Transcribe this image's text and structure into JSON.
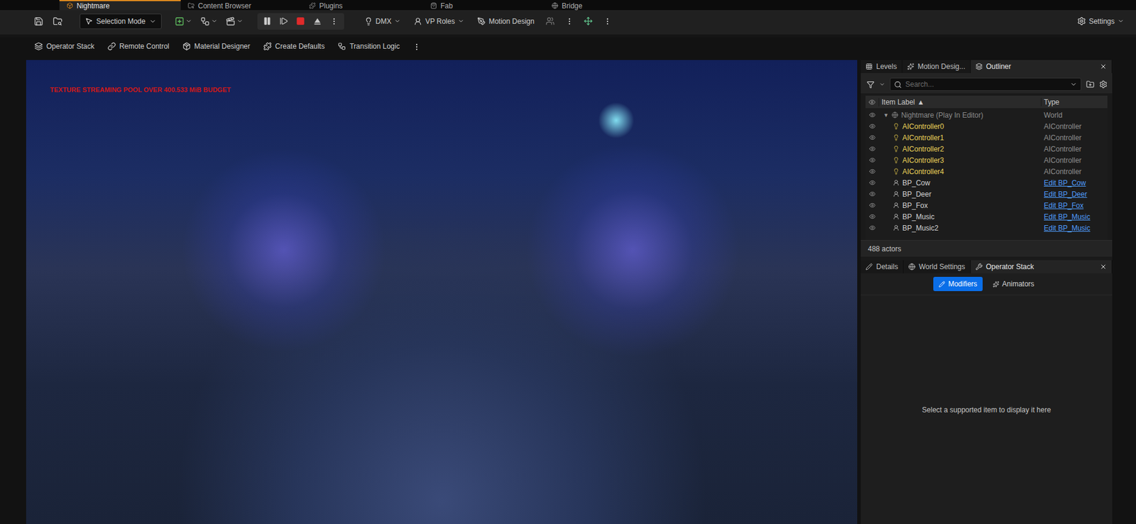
{
  "window_tabs": [
    {
      "label": "Nightmare",
      "selected": true
    },
    {
      "label": "Content Browser",
      "selected": false
    },
    {
      "label": "Plugins",
      "selected": false
    },
    {
      "label": "Fab",
      "selected": false
    },
    {
      "label": "Bridge",
      "selected": false
    }
  ],
  "toolbar": {
    "mode": "Selection Mode",
    "menus": [
      "DMX",
      "VP Roles",
      "Motion Design"
    ],
    "settings": "Settings"
  },
  "quick_bar": [
    "Operator Stack",
    "Remote Control",
    "Material Designer",
    "Create Defaults",
    "Transition Logic"
  ],
  "viewport": {
    "warning": "TEXTURE STREAMING POOL OVER 400.533 MiB BUDGET"
  },
  "outliner": {
    "tabs": [
      {
        "label": "Levels",
        "selected": false
      },
      {
        "label": "Motion Desig...",
        "selected": false
      },
      {
        "label": "Outliner",
        "selected": true
      }
    ],
    "search_placeholder": "Search...",
    "columns": [
      {
        "label": "Item Label",
        "sort": "▲"
      },
      {
        "label": "Type",
        "sort": ""
      }
    ],
    "rows": [
      {
        "label": "Nightmare (Play In Editor)",
        "type": "World",
        "kind": "world",
        "expanded": true,
        "link": false
      },
      {
        "label": "AIController0",
        "type": "AIController",
        "kind": "spawned",
        "expanded": false,
        "link": false
      },
      {
        "label": "AIController1",
        "type": "AIController",
        "kind": "spawned",
        "expanded": false,
        "link": false
      },
      {
        "label": "AIController2",
        "type": "AIController",
        "kind": "spawned",
        "expanded": false,
        "link": false
      },
      {
        "label": "AIController3",
        "type": "AIController",
        "kind": "spawned",
        "expanded": false,
        "link": false
      },
      {
        "label": "AIController4",
        "type": "AIController",
        "kind": "spawned",
        "expanded": false,
        "link": false
      },
      {
        "label": "BP_Cow",
        "type": "Edit BP_Cow",
        "kind": "actor",
        "expanded": false,
        "link": true
      },
      {
        "label": "BP_Deer",
        "type": "Edit BP_Deer",
        "kind": "actor",
        "expanded": false,
        "link": true
      },
      {
        "label": "BP_Fox",
        "type": "Edit BP_Fox",
        "kind": "actor",
        "expanded": false,
        "link": true
      },
      {
        "label": "BP_Music",
        "type": "Edit BP_Music",
        "kind": "actor",
        "expanded": false,
        "link": true
      },
      {
        "label": "BP_Music2",
        "type": "Edit BP_Music",
        "kind": "actor",
        "expanded": false,
        "link": true
      }
    ],
    "count": "488 actors"
  },
  "details": {
    "tabs": [
      {
        "label": "Details",
        "selected": false
      },
      {
        "label": "World Settings",
        "selected": false
      },
      {
        "label": "Operator Stack",
        "selected": true
      }
    ],
    "modes": [
      {
        "label": "Modifiers",
        "selected": true
      },
      {
        "label": "Animators",
        "selected": false
      }
    ],
    "empty_message": "Select a supported item to display it here"
  }
}
